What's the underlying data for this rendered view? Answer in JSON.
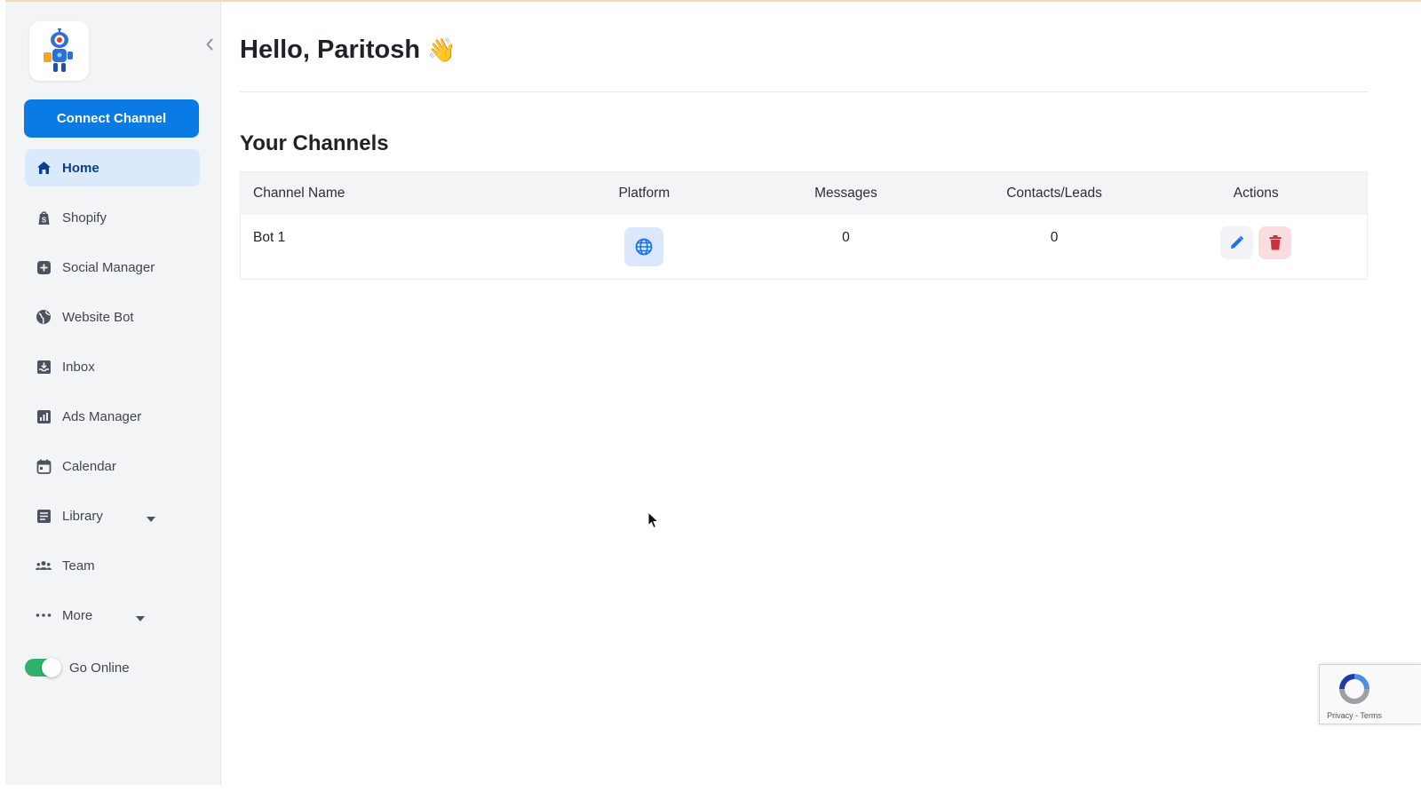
{
  "sidebar": {
    "connect_label": "Connect Channel",
    "items": [
      {
        "label": "Home",
        "icon": "home-icon"
      },
      {
        "label": "Shopify",
        "icon": "shopify-icon"
      },
      {
        "label": "Social Manager",
        "icon": "plus-square-icon"
      },
      {
        "label": "Website Bot",
        "icon": "globe-icon"
      },
      {
        "label": "Inbox",
        "icon": "inbox-icon"
      },
      {
        "label": "Ads Manager",
        "icon": "bar-chart-icon"
      },
      {
        "label": "Calendar",
        "icon": "calendar-icon"
      },
      {
        "label": "Library",
        "icon": "document-icon"
      },
      {
        "label": "Team",
        "icon": "team-icon"
      },
      {
        "label": "More",
        "icon": "more-dots-icon"
      }
    ],
    "toggle_label": "Go Online",
    "toggle_on": true
  },
  "main": {
    "greeting": "Hello, Paritosh",
    "greeting_emoji": "👋",
    "section_title": "Your Channels",
    "table": {
      "headers": [
        "Channel Name",
        "Platform",
        "Messages",
        "Contacts/Leads",
        "Actions"
      ],
      "rows": [
        {
          "name": "Bot 1",
          "platform_icon": "globe-icon",
          "messages": "0",
          "contacts": "0"
        }
      ]
    }
  },
  "recaptcha": {
    "text": "Privacy - Terms"
  },
  "colors": {
    "accent": "#0a7be4",
    "active_bg": "#dbeafb",
    "toggle": "#2fb36a",
    "delete": "#c8323f"
  }
}
